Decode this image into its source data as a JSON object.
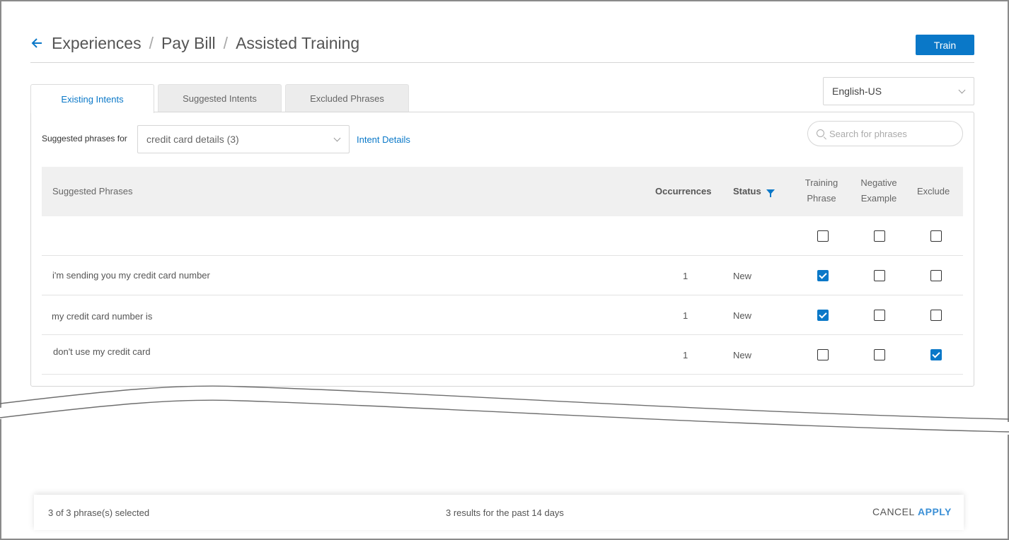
{
  "breadcrumb": {
    "items": [
      "Experiences",
      "Pay Bill",
      "Assisted Training"
    ],
    "separator": "/"
  },
  "header": {
    "train_label": "Train"
  },
  "tabs": [
    {
      "label": "Existing Intents",
      "active": true
    },
    {
      "label": "Suggested Intents",
      "active": false
    },
    {
      "label": "Excluded Phrases",
      "active": false
    }
  ],
  "language": {
    "selected": "English-US"
  },
  "filters": {
    "suggested_for_label": "Suggested phrases for",
    "intent_selected": "credit card details (3)",
    "intent_details_link": "Intent Details",
    "search_placeholder": "Search for phrases"
  },
  "table": {
    "columns": {
      "phrase": "Suggested Phrases",
      "occurrences": "Occurrences",
      "status": "Status",
      "training_line1": "Training",
      "training_line2": "Phrase",
      "negative_line1": "Negative",
      "negative_line2": "Example",
      "exclude": "Exclude"
    },
    "rows": [
      {
        "phrase": "i'm sending you my credit card number",
        "occurrences": "1",
        "status": "New",
        "training": true,
        "negative": false,
        "exclude": false
      },
      {
        "phrase": "my credit card number is",
        "occurrences": "1",
        "status": "New",
        "training": true,
        "negative": false,
        "exclude": false
      },
      {
        "phrase": "don't use my credit card",
        "occurrences": "1",
        "status": "New",
        "training": false,
        "negative": false,
        "exclude": true
      }
    ]
  },
  "footer": {
    "selected_text": "3 of 3 phrase(s) selected",
    "results_text": "3 results for the past 14 days",
    "cancel_label": "CANCEL",
    "apply_label": "APPLY"
  },
  "colors": {
    "accent": "#0a78c8",
    "apply": "#3a8fd6"
  }
}
